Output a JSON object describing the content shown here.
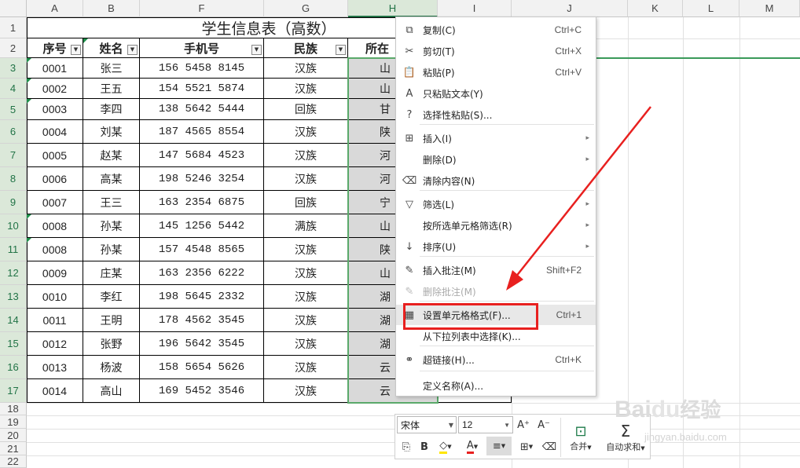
{
  "columns": [
    "A",
    "B",
    "F",
    "G",
    "H",
    "I",
    "J",
    "K",
    "L",
    "M"
  ],
  "rows": [
    "1",
    "2",
    "3",
    "4",
    "5",
    "6",
    "7",
    "8",
    "9",
    "10",
    "11",
    "12",
    "13",
    "14",
    "15",
    "16",
    "17",
    "18",
    "19",
    "20",
    "21",
    "22"
  ],
  "title": "学生信息表（高数）",
  "headers": [
    "序号",
    "姓名",
    "手机号",
    "民族",
    "所在"
  ],
  "filter_glyph": "▼",
  "data": [
    [
      "0001",
      "张三",
      "156 5458 8145",
      "汉族",
      "山"
    ],
    [
      "0002",
      "王五",
      "154 5521 5874",
      "汉族",
      "山"
    ],
    [
      "0003",
      "李四",
      "138 5642 5444",
      "回族",
      "甘"
    ],
    [
      "0004",
      "刘某",
      "187 4565 8554",
      "汉族",
      "陕"
    ],
    [
      "0005",
      "赵某",
      "147 5684 4523",
      "汉族",
      "河"
    ],
    [
      "0006",
      "高某",
      "198 5246 3254",
      "汉族",
      "河"
    ],
    [
      "0007",
      "王三",
      "163 2354 6875",
      "回族",
      "宁"
    ],
    [
      "0008",
      "孙某",
      "145 1256 5442",
      "满族",
      "山"
    ],
    [
      "0008",
      "孙某",
      "157 4548 8565",
      "汉族",
      "陕"
    ],
    [
      "0009",
      "庄某",
      "163 2356 6222",
      "汉族",
      "山"
    ],
    [
      "0010",
      "李红",
      "198 5645 2332",
      "汉族",
      "湖"
    ],
    [
      "0011",
      "王明",
      "178 4562 3545",
      "汉族",
      "湖"
    ],
    [
      "0012",
      "张野",
      "196 5642 3545",
      "汉族",
      "湖"
    ],
    [
      "0013",
      "杨波",
      "158 5654 5626",
      "汉族",
      "云"
    ],
    [
      "0014",
      "高山",
      "169 5452 3546",
      "汉族",
      "云"
    ]
  ],
  "menu": [
    {
      "icon": "⧉",
      "label": "复制(C)",
      "shortcut": "Ctrl+C"
    },
    {
      "icon": "✂",
      "label": "剪切(T)",
      "shortcut": "Ctrl+X"
    },
    {
      "icon": "📋",
      "label": "粘贴(P)",
      "shortcut": "Ctrl+V"
    },
    {
      "icon": "A",
      "label": "只粘贴文本(Y)",
      "shortcut": ""
    },
    {
      "icon": "?",
      "label": "选择性粘贴(S)...",
      "shortcut": ""
    },
    {
      "icon": "⊞",
      "label": "插入(I)",
      "shortcut": "",
      "arrow": "▸"
    },
    {
      "icon": "",
      "label": "删除(D)",
      "shortcut": "",
      "arrow": "▸"
    },
    {
      "icon": "⌫",
      "label": "清除内容(N)",
      "shortcut": ""
    },
    {
      "icon": "▽",
      "label": "筛选(L)",
      "shortcut": "",
      "arrow": "▸"
    },
    {
      "icon": "",
      "label": "按所选单元格筛选(R)",
      "shortcut": "",
      "arrow": "▸"
    },
    {
      "icon": "↓",
      "label": "排序(U)",
      "shortcut": "",
      "arrow": "▸"
    },
    {
      "icon": "✎",
      "label": "插入批注(M)",
      "shortcut": "Shift+F2"
    },
    {
      "icon": "✎",
      "label": "删除批注(M)",
      "shortcut": ""
    },
    {
      "icon": "▦",
      "label": "设置单元格格式(F)...",
      "shortcut": "Ctrl+1"
    },
    {
      "icon": "",
      "label": "从下拉列表中选择(K)...",
      "shortcut": ""
    },
    {
      "icon": "⚭",
      "label": "超链接(H)...",
      "shortcut": "Ctrl+K"
    },
    {
      "icon": "",
      "label": "定义名称(A)...",
      "shortcut": ""
    }
  ],
  "toolbar": {
    "font_name": "宋体",
    "font_size": "12",
    "grow_font": "A⁺",
    "shrink_font": "A⁻",
    "bold": "B",
    "font_color": "A",
    "merge_label": "合并",
    "autosum_label": "自动求和",
    "sigma": "Σ"
  },
  "watermark": {
    "brand": "Bai",
    "paw": "du",
    "cn": "经验",
    "url": "jingyan.baidu.com"
  },
  "colors": {
    "accent_green": "#217346",
    "highlight_red": "#e8201f",
    "selected_cell": "#d9d9d9"
  }
}
